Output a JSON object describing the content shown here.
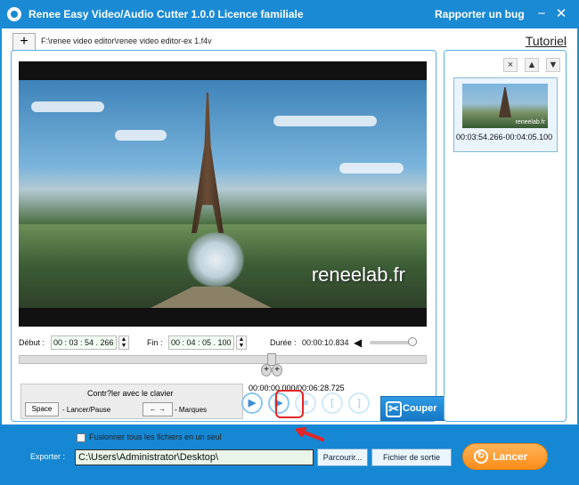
{
  "titlebar": {
    "app_title": "Renee Easy Video/Audio Cutter 1.0.0 Licence familiale",
    "report_bug": "Rapporter un bug",
    "minimize_icon": "−",
    "close_icon": "✕"
  },
  "toolbar": {
    "add_icon": "+",
    "file_path": "F:\\renee video editor\\renee video editor-ex 1.f4v",
    "tutorial": "Tutoriel"
  },
  "video": {
    "watermark": "reneelab.fr"
  },
  "cut_range": {
    "start_label": "Début :",
    "start_time": "00 : 03 : 54 . 266",
    "end_label": "Fin :",
    "end_time": "00 : 04 : 05 . 100",
    "duration_label": "Durée :",
    "duration_value": "00:00:10.834"
  },
  "playback": {
    "elapsed_total": "00:00:00.000/00:06:28.725",
    "progress_fraction": 0.61
  },
  "keyboard": {
    "title": "Contr?ler avec le clavier",
    "space_key": "Space",
    "space_action": "- Lancer/Pause",
    "arrow_keys": "← →",
    "arrow_action": "- Marques"
  },
  "actions": {
    "cut_label": "Couper"
  },
  "clip_list": {
    "items": [
      {
        "time_range": "00:03:54.266-00:04:05.100",
        "watermark": "reneelab.fr"
      }
    ]
  },
  "footer": {
    "merge_label": "Fusionner tous les fichiers en un seul",
    "merge_checked": false,
    "export_label": "Exporter :",
    "export_path": "C:\\Users\\Administrator\\Desktop\\",
    "browse_label": "Parcourir...",
    "output_file_label": "Fichier de sortie",
    "launch_label": "Lancer"
  },
  "colors": {
    "titlebar": "#1a8ad4",
    "panel_border": "#5aaee8",
    "cut_button": "#1678c6",
    "launch_button": "#ff8d19",
    "annotation_red": "#e12626"
  },
  "icons": [
    "app-logo-icon",
    "add-file-icon",
    "delete-icon",
    "move-up-icon",
    "move-down-icon",
    "play-icon",
    "preview-icon",
    "stop-icon",
    "mark-start-icon",
    "mark-end-icon",
    "scissors-icon",
    "refresh-icon"
  ]
}
